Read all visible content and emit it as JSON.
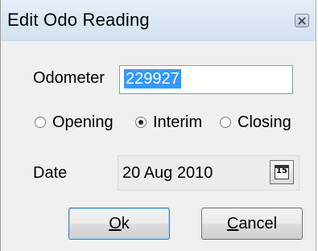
{
  "window": {
    "title": "Edit Odo Reading",
    "close_icon": "close-icon"
  },
  "odometer": {
    "label": "Odometer",
    "value": "229927"
  },
  "reading_type": {
    "options": [
      {
        "label": "Opening",
        "checked": false
      },
      {
        "label": "Interim",
        "checked": true
      },
      {
        "label": "Closing",
        "checked": false
      }
    ]
  },
  "date": {
    "label": "Date",
    "value": "20 Aug 2010",
    "calendar_day": "15",
    "calendar_icon": "calendar-icon"
  },
  "buttons": {
    "ok": {
      "accel": "O",
      "rest": "k"
    },
    "cancel": {
      "accel": "C",
      "rest": "ancel"
    }
  }
}
